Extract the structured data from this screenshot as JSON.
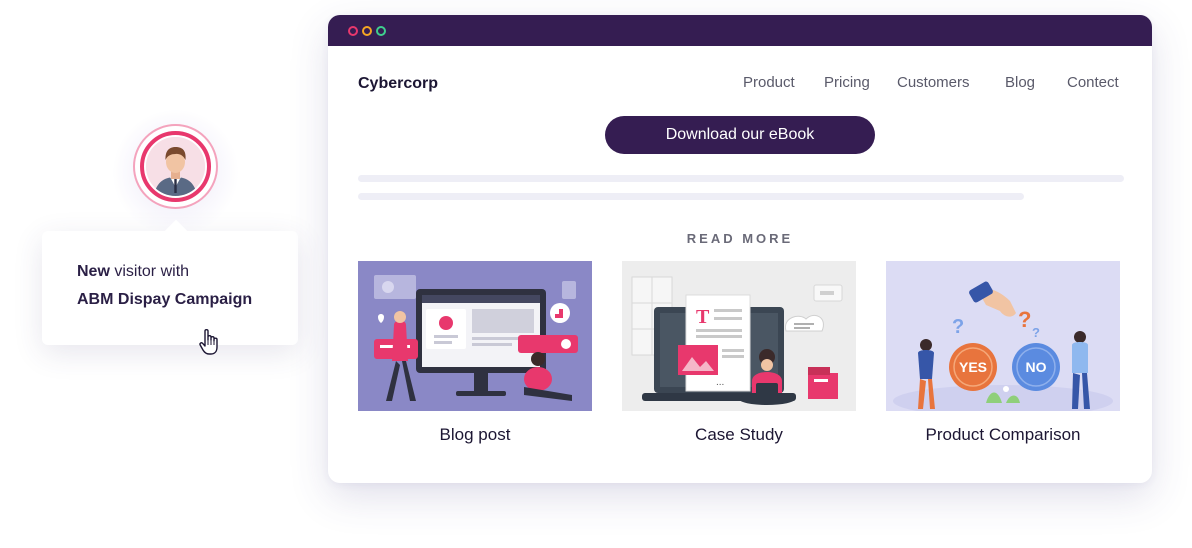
{
  "visitor": {
    "line1_bold": "New",
    "line1_rest": " visitor with",
    "line2": "ABM Dispay Campaign"
  },
  "browser": {
    "brand": "Cybercorp",
    "nav": [
      "Product",
      "Pricing",
      "Customers",
      "Blog",
      "Contect"
    ],
    "cta_label": "Download our eBook",
    "section_heading": "READ MORE",
    "cards": [
      {
        "label": "Blog post"
      },
      {
        "label": "Case Study"
      },
      {
        "label": "Product Comparison"
      }
    ],
    "comparison_yes": "YES",
    "comparison_no": "NO"
  },
  "colors": {
    "brand_dark": "#351d52",
    "accent_pink": "#e8386d",
    "dot_yellow": "#f5a623",
    "dot_green": "#3fcf8e",
    "card1_bg": "#8a88c6",
    "card2_bg": "#ededed",
    "card3_bg": "#dcdcf4"
  }
}
